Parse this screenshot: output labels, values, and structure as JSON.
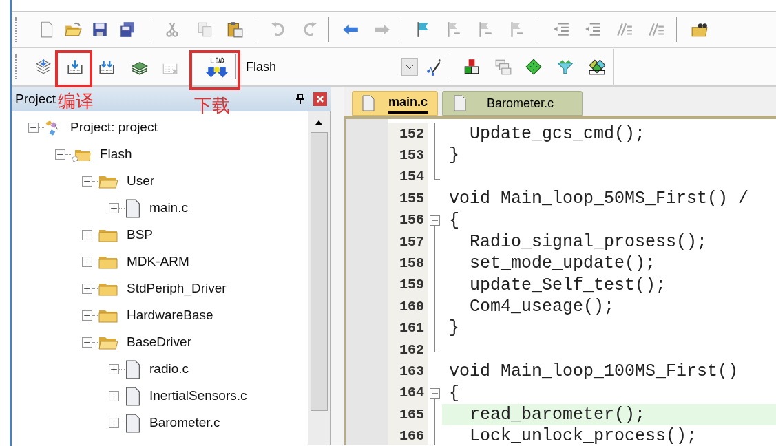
{
  "toolbar_build": {
    "target_select": {
      "value": "Flash"
    }
  },
  "annotations": [
    {
      "label": "编译"
    },
    {
      "label": "下载"
    }
  ],
  "project_panel": {
    "title": "Project",
    "tree": [
      {
        "label": "Project: project",
        "kind": "project",
        "expanded": true,
        "children": [
          {
            "label": "Flash",
            "kind": "target",
            "expanded": true,
            "children": [
              {
                "label": "User",
                "kind": "folder",
                "expanded": true,
                "children": [
                  {
                    "label": "main.c",
                    "kind": "file",
                    "expanded": false
                  }
                ]
              },
              {
                "label": "BSP",
                "kind": "folder",
                "expanded": false
              },
              {
                "label": "MDK-ARM",
                "kind": "folder",
                "expanded": false
              },
              {
                "label": "StdPeriph_Driver",
                "kind": "folder",
                "expanded": false
              },
              {
                "label": "HardwareBase",
                "kind": "folder",
                "expanded": false
              },
              {
                "label": "BaseDriver",
                "kind": "folder",
                "expanded": true,
                "children": [
                  {
                    "label": "radio.c",
                    "kind": "file",
                    "expanded": false
                  },
                  {
                    "label": "InertialSensors.c",
                    "kind": "file",
                    "expanded": false
                  },
                  {
                    "label": "Barometer.c",
                    "kind": "file",
                    "expanded": false
                  }
                ]
              }
            ]
          }
        ]
      }
    ]
  },
  "editor": {
    "tabs": [
      {
        "label": "main.c",
        "selected": true
      },
      {
        "label": "Barometer.c",
        "selected": false
      }
    ],
    "lines": [
      {
        "number": "152",
        "text": "  Update_gcs_cmd();",
        "kind": "body",
        "highlighted": false
      },
      {
        "number": "153",
        "text": "}",
        "kind": "body",
        "highlighted": false
      },
      {
        "number": "154",
        "kind": "end",
        "highlighted": false
      },
      {
        "number": "155",
        "text": "void Main_loop_50MS_First() /",
        "kind": "plain",
        "highlighted": false
      },
      {
        "number": "156",
        "text": "{",
        "kind": "start",
        "highlighted": false
      },
      {
        "number": "157",
        "text": "  Radio_signal_prosess();",
        "kind": "body",
        "highlighted": false
      },
      {
        "number": "158",
        "text": "  set_mode_update();",
        "kind": "body",
        "highlighted": false
      },
      {
        "number": "159",
        "text": "  update_Self_test();",
        "kind": "body",
        "highlighted": false
      },
      {
        "number": "160",
        "text": "  Com4_useage();",
        "kind": "body",
        "highlighted": false
      },
      {
        "number": "161",
        "text": "}",
        "kind": "body",
        "highlighted": false
      },
      {
        "number": "162",
        "kind": "end",
        "highlighted": false
      },
      {
        "number": "163",
        "text": "void Main_loop_100MS_First()",
        "kind": "plain",
        "highlighted": false
      },
      {
        "number": "164",
        "text": "{",
        "kind": "start",
        "highlighted": false
      },
      {
        "number": "165",
        "text": "  read_barometer();",
        "kind": "body",
        "highlighted": true
      },
      {
        "number": "166",
        "text": "  Lock_unlock_process();",
        "kind": "body",
        "highlighted": false
      }
    ]
  }
}
